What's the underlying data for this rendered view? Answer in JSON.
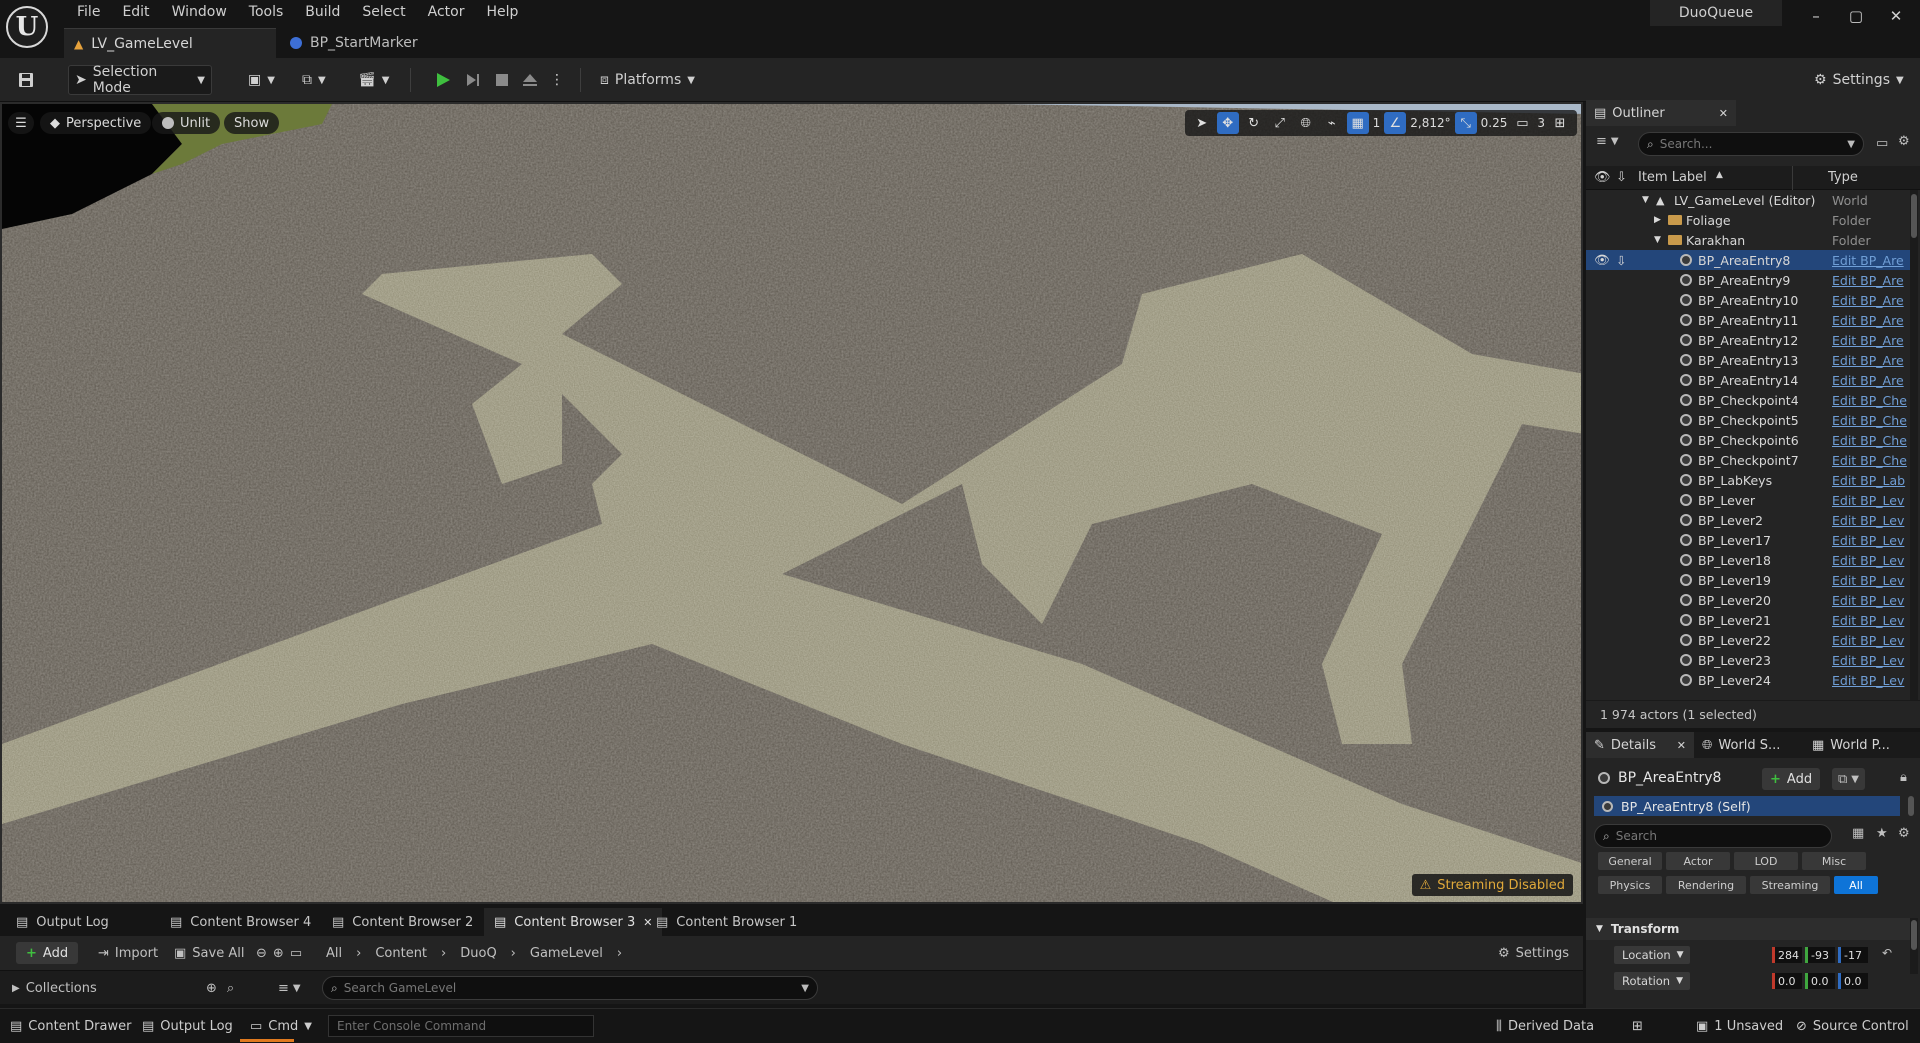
{
  "app": {
    "logo_letter": "U",
    "project_name": "DuoQueue",
    "window_controls": [
      "–",
      "▢",
      "✕"
    ]
  },
  "menu": [
    "File",
    "Edit",
    "Window",
    "Tools",
    "Build",
    "Select",
    "Actor",
    "Help"
  ],
  "doc_tabs": [
    {
      "label": "LV_GameLevel",
      "active": true
    },
    {
      "label": "BP_StartMarker",
      "active": false
    }
  ],
  "toolbar": {
    "selection_mode": "Selection Mode",
    "platforms": "Platforms",
    "settings": "Settings"
  },
  "viewport": {
    "perspective": "Perspective",
    "lit_mode": "Unlit",
    "show": "Show",
    "grid_snap": "1",
    "rotation_snap": "2,812°",
    "scale_snap": "0.25",
    "camera_speed": "3",
    "streaming_warning": "Streaming Disabled"
  },
  "bottom_tabs": [
    {
      "label": "Output Log",
      "active": false
    },
    {
      "label": "Content Browser 4",
      "active": false
    },
    {
      "label": "Content Browser 2",
      "active": false
    },
    {
      "label": "Content Browser 3",
      "active": true
    },
    {
      "label": "Content Browser 1",
      "active": false
    }
  ],
  "content_browser": {
    "add": "Add",
    "import": "Import",
    "save_all": "Save All",
    "breadcrumb": [
      "All",
      "Content",
      "DuoQ",
      "GameLevel"
    ],
    "settings": "Settings",
    "collections": "Collections",
    "search_placeholder": "Search GameLevel"
  },
  "statusbar": {
    "content_drawer": "Content Drawer",
    "output_log": "Output Log",
    "cmd": "Cmd",
    "console_placeholder": "Enter Console Command",
    "derived_data": "Derived Data",
    "unsaved": "1 Unsaved",
    "source_control": "Source Control"
  },
  "outliner": {
    "title": "Outliner",
    "search_placeholder": "Search...",
    "col_label": "Item Label",
    "col_type": "Type",
    "footer": "1 974 actors (1 selected)",
    "rows": [
      {
        "label": "LV_GameLevel (Editor)",
        "type": "World",
        "kind": "world",
        "indent": 0
      },
      {
        "label": "Foliage",
        "type": "Folder",
        "kind": "folder",
        "indent": 1
      },
      {
        "label": "Karakhan",
        "type": "Folder",
        "kind": "folder-open",
        "indent": 1
      },
      {
        "label": "BP_AreaEntry8",
        "type": "Edit BP_Are",
        "kind": "actor",
        "indent": 2,
        "selected": true
      },
      {
        "label": "BP_AreaEntry9",
        "type": "Edit BP_Are",
        "kind": "actor",
        "indent": 2
      },
      {
        "label": "BP_AreaEntry10",
        "type": "Edit BP_Are",
        "kind": "actor",
        "indent": 2
      },
      {
        "label": "BP_AreaEntry11",
        "type": "Edit BP_Are",
        "kind": "actor",
        "indent": 2
      },
      {
        "label": "BP_AreaEntry12",
        "type": "Edit BP_Are",
        "kind": "actor",
        "indent": 2
      },
      {
        "label": "BP_AreaEntry13",
        "type": "Edit BP_Are",
        "kind": "actor",
        "indent": 2
      },
      {
        "label": "BP_AreaEntry14",
        "type": "Edit BP_Are",
        "kind": "actor",
        "indent": 2
      },
      {
        "label": "BP_Checkpoint4",
        "type": "Edit BP_Che",
        "kind": "actor",
        "indent": 2
      },
      {
        "label": "BP_Checkpoint5",
        "type": "Edit BP_Che",
        "kind": "actor",
        "indent": 2
      },
      {
        "label": "BP_Checkpoint6",
        "type": "Edit BP_Che",
        "kind": "actor",
        "indent": 2
      },
      {
        "label": "BP_Checkpoint7",
        "type": "Edit BP_Che",
        "kind": "actor",
        "indent": 2
      },
      {
        "label": "BP_LabKeys",
        "type": "Edit BP_Lab",
        "kind": "actor",
        "indent": 2
      },
      {
        "label": "BP_Lever",
        "type": "Edit BP_Lev",
        "kind": "actor",
        "indent": 2
      },
      {
        "label": "BP_Lever2",
        "type": "Edit BP_Lev",
        "kind": "actor",
        "indent": 2
      },
      {
        "label": "BP_Lever17",
        "type": "Edit BP_Lev",
        "kind": "actor",
        "indent": 2
      },
      {
        "label": "BP_Lever18",
        "type": "Edit BP_Lev",
        "kind": "actor",
        "indent": 2
      },
      {
        "label": "BP_Lever19",
        "type": "Edit BP_Lev",
        "kind": "actor",
        "indent": 2
      },
      {
        "label": "BP_Lever20",
        "type": "Edit BP_Lev",
        "kind": "actor",
        "indent": 2
      },
      {
        "label": "BP_Lever21",
        "type": "Edit BP_Lev",
        "kind": "actor",
        "indent": 2
      },
      {
        "label": "BP_Lever22",
        "type": "Edit BP_Lev",
        "kind": "actor",
        "indent": 2
      },
      {
        "label": "BP_Lever23",
        "type": "Edit BP_Lev",
        "kind": "actor",
        "indent": 2
      },
      {
        "label": "BP_Lever24",
        "type": "Edit BP_Lev",
        "kind": "actor",
        "indent": 2
      }
    ]
  },
  "details": {
    "tabs": [
      "Details",
      "World S...",
      "World P..."
    ],
    "actor_name": "BP_AreaEntry8",
    "add": "Add",
    "component_self": "BP_AreaEntry8 (Self)",
    "search_placeholder": "Search",
    "filters_row1": [
      "General",
      "Actor",
      "LOD",
      "Misc"
    ],
    "filters_row2": [
      "Physics",
      "Rendering",
      "Streaming",
      "All"
    ],
    "active_filter": "All",
    "section": "Transform",
    "location_label": "Location",
    "location": [
      "284",
      "-93",
      "-17"
    ],
    "rotation_label": "Rotation",
    "rotation": [
      "0.0",
      "0.0",
      "0.0"
    ]
  },
  "colors": {
    "accent_blue": "#0e74d8",
    "selection": "#23467a",
    "play_green": "#3fbf3f",
    "warning": "#e0a93a"
  }
}
